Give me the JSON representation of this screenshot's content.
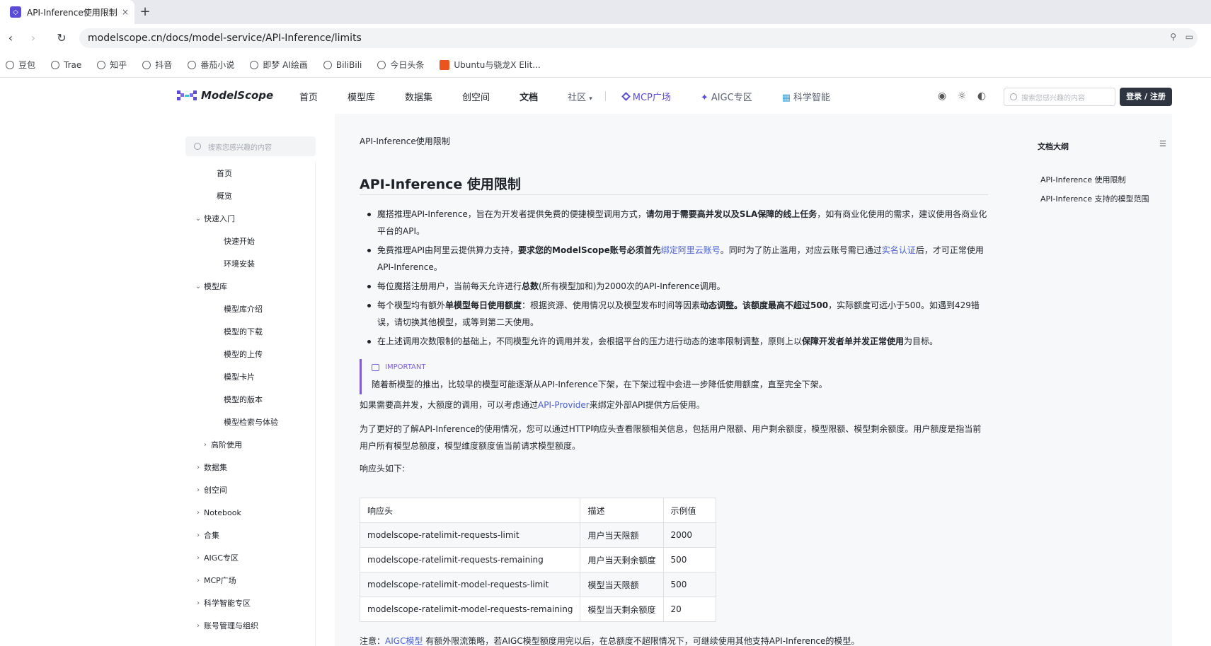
{
  "browser": {
    "tab_title": "API-Inference使用限制",
    "tab_close": "×",
    "new_tab": "+",
    "back": "‹",
    "forward": "›",
    "reload": "↻",
    "url": "modelscope.cn/docs/model-service/API-Inference/limits",
    "bookmarks": [
      "豆包",
      "Trae",
      "知乎",
      "抖音",
      "番茄小说",
      "即梦 AI绘画",
      "BiliBili",
      "今日头条",
      "Ubuntu与骁龙X Elit..."
    ]
  },
  "site": {
    "logo_text": "ModelScope",
    "nav": {
      "home": "首页",
      "models": "模型库",
      "datasets": "数据集",
      "studios": "创空间",
      "docs": "文档",
      "community": "社区",
      "mcp": "MCP广场",
      "aigc": "AIGC专区",
      "science": "科学智能"
    },
    "search_placeholder": "搜索您感兴趣的内容",
    "login": "登录 / 注册"
  },
  "sidebar": {
    "search_placeholder": "搜索您感兴趣的内容",
    "items": [
      {
        "label": "首页",
        "chev": ""
      },
      {
        "label": "概览",
        "chev": ""
      },
      {
        "label": "快速入门",
        "chev": "⌄"
      },
      {
        "label": "快速开始",
        "chev": ""
      },
      {
        "label": "环境安装",
        "chev": ""
      },
      {
        "label": "模型库",
        "chev": "⌄"
      },
      {
        "label": "模型库介绍",
        "chev": ""
      },
      {
        "label": "模型的下载",
        "chev": ""
      },
      {
        "label": "模型的上传",
        "chev": ""
      },
      {
        "label": "模型卡片",
        "chev": ""
      },
      {
        "label": "模型的版本",
        "chev": ""
      },
      {
        "label": "模型检索与体验",
        "chev": ""
      },
      {
        "label": "高阶使用",
        "chev": "›"
      },
      {
        "label": "数据集",
        "chev": "›"
      },
      {
        "label": "创空间",
        "chev": "›"
      },
      {
        "label": "Notebook",
        "chev": "›"
      },
      {
        "label": "合集",
        "chev": "›"
      },
      {
        "label": "AIGC专区",
        "chev": "›"
      },
      {
        "label": "MCP广场",
        "chev": "›"
      },
      {
        "label": "科学智能专区",
        "chev": "›"
      },
      {
        "label": "账号管理与组织",
        "chev": "›"
      }
    ]
  },
  "content": {
    "breadcrumb": "API-Inference使用限制",
    "title": "API-Inference 使用限制",
    "bullet1": {
      "a": "魔搭推理API-Inference，旨在为开发者提供免费的便捷模型调用方式，",
      "b": "请勿用于需要高并发以及SLA保障的线上任务",
      "c": "，如有商业化使用的需求，建议使用各商业化平台的API。"
    },
    "bullet2": {
      "a": "免费推理API由阿里云提供算力支持，",
      "b": "要求您的ModelScope账号必须首先",
      "link1": "绑定阿里云账号",
      "c": "。同时为了防止滥用，对应云账号需已通过",
      "link2": "实名认证",
      "d": "后，才可正常使用API-Inference。"
    },
    "bullet3": {
      "a": "每位魔搭注册用户，当前每天允许进行",
      "b": "总数",
      "c": "(所有模型加和)为2000次的API-Inference调用。"
    },
    "bullet4": {
      "a": "每个模型均有额外",
      "b": "单模型每日使用额度",
      "c": "：根据资源、使用情况以及模型发布时间等因素",
      "d": "动态调整。该额度最高不超过500",
      "e": "，实际额度可远小于500。如遇到429错误，请切换其他模型，或等到第二天使用。"
    },
    "bullet5": {
      "a": "在上述调用次数限制的基础上，不同模型允许的调用并发，会根据平台的压力进行动态的速率限制调整，原则上以",
      "b": "保障开发者单并发正常使用",
      "c": "为目标。"
    },
    "callout": {
      "label": "IMPORTANT",
      "text": "随着新模型的推出，比较早的模型可能逐渐从API-Inference下架，在下架过程中会进一步降低使用额度，直至完全下架。"
    },
    "para1": {
      "a": "如果需要高并发，大额度的调用，可以考虑通过",
      "link": "API-Provider",
      "b": "来绑定外部API提供方后使用。"
    },
    "para2": "为了更好的了解API-Inference的使用情况，您可以通过HTTP响应头查看限额相关信息，包括用户限额、用户剩余额度，模型限额、模型剩余额度。用户额度是指当前用户所有模型总额度，模型维度额度值当前请求模型额度。",
    "para3": "响应头如下:",
    "table": {
      "headers": [
        "响应头",
        "描述",
        "示例值"
      ],
      "rows": [
        [
          "modelscope-ratelimit-requests-limit",
          "用户当天限额",
          "2000"
        ],
        [
          "modelscope-ratelimit-requests-remaining",
          "用户当天剩余额度",
          "500"
        ],
        [
          "modelscope-ratelimit-model-requests-limit",
          "模型当天限额",
          "500"
        ],
        [
          "modelscope-ratelimit-model-requests-remaining",
          "模型当天剩余额度",
          "20"
        ]
      ]
    },
    "note": {
      "a": "注意：",
      "link": "AIGC模型",
      "b": " 有额外限流策略，若AIGC模型额度用完以后，在总额度不超限情况下，可继续使用其他支持API-Inference的模型。"
    }
  },
  "outline": {
    "title": "文档大纲",
    "links": [
      "API-Inference 使用限制",
      "API-Inference 支持的模型范围"
    ]
  },
  "colors": {
    "accent": "#5b4bdb",
    "link": "#4a5fd8",
    "callout": "#7b5cd6"
  }
}
